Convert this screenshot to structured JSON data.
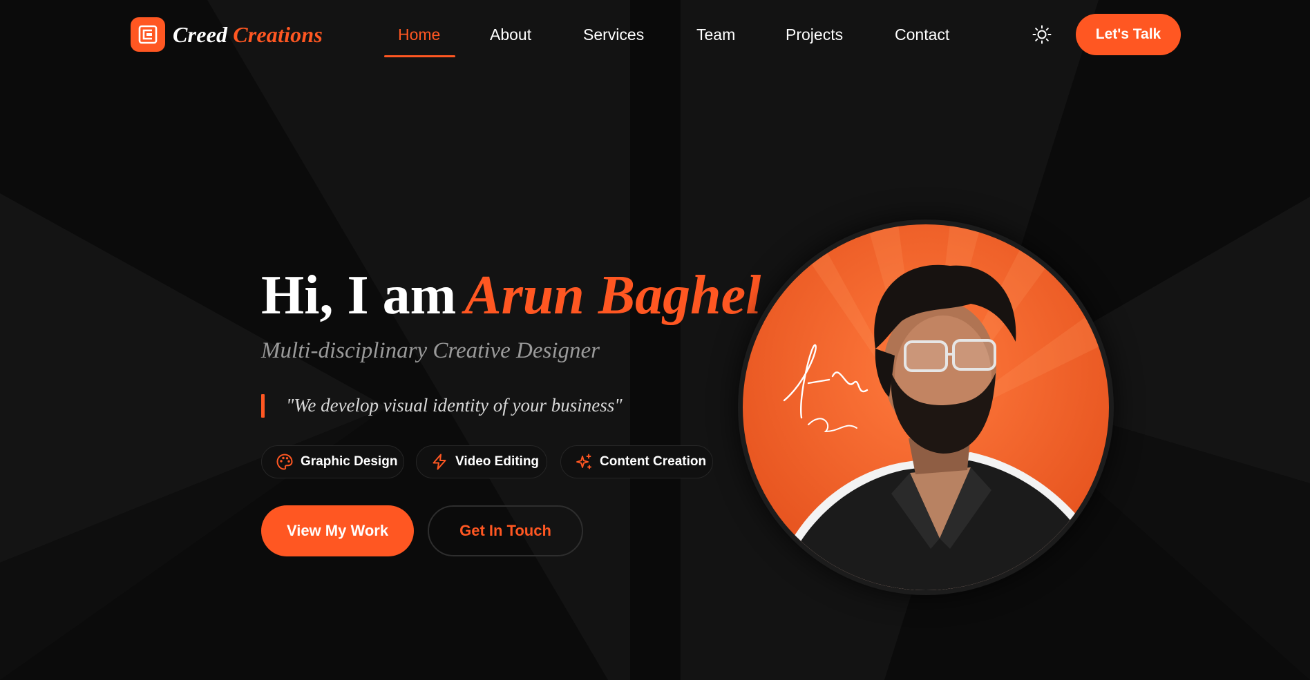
{
  "brand": {
    "name_part1": "Creed",
    "name_part2": "Creations",
    "logo_icon": "brand-logo-icon"
  },
  "nav": {
    "items": [
      {
        "label": "Home",
        "active": true
      },
      {
        "label": "About",
        "active": false
      },
      {
        "label": "Services",
        "active": false
      },
      {
        "label": "Team",
        "active": false
      },
      {
        "label": "Projects",
        "active": false
      },
      {
        "label": "Contact",
        "active": false
      }
    ],
    "theme_toggle_icon": "sun-icon",
    "cta_label": "Let's Talk"
  },
  "hero": {
    "greeting": "Hi, I am",
    "name": "Arun Baghel",
    "subtitle": "Multi-disciplinary Creative Designer",
    "quote": "\"We develop visual identity of your business\"",
    "chips": [
      {
        "label": "Graphic Design",
        "icon": "palette-icon"
      },
      {
        "label": "Video Editing",
        "icon": "lightning-icon"
      },
      {
        "label": "Content Creation",
        "icon": "sparkles-icon"
      }
    ],
    "primary_button": "View My Work",
    "secondary_button": "Get In Touch",
    "portrait_icon": "portrait-photo"
  },
  "colors": {
    "accent": "#ff5722",
    "background": "#0b0b0b",
    "text": "#ffffff",
    "muted_text": "#9a9a9a"
  }
}
